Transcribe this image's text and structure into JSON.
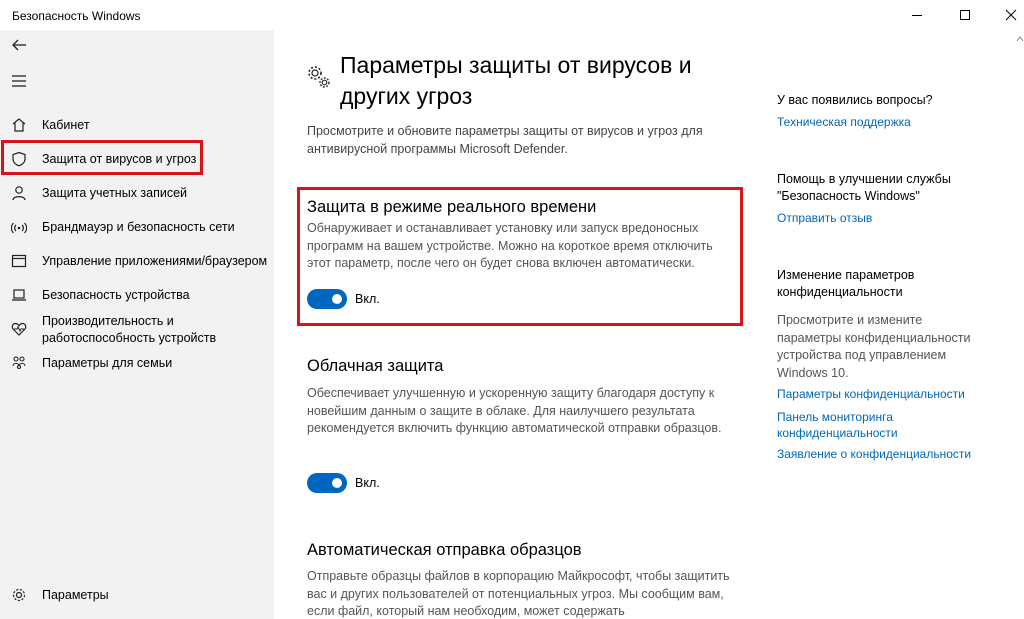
{
  "window": {
    "title": "Безопасность Windows",
    "buttons": {
      "minimize": "minimize-icon",
      "maximize": "maximize-icon",
      "close": "close-icon"
    }
  },
  "sidebar": {
    "back_icon": "back-arrow-icon",
    "menu_icon": "hamburger-icon",
    "items": [
      {
        "label": "Кабинет",
        "icon": "home-icon"
      },
      {
        "label": "Защита от вирусов и угроз",
        "icon": "shield-icon",
        "active": true
      },
      {
        "label": "Защита учетных записей",
        "icon": "person-icon"
      },
      {
        "label": "Брандмауэр и безопасность сети",
        "icon": "wifi-icon"
      },
      {
        "label": "Управление приложениями/браузером",
        "icon": "app-window-icon"
      },
      {
        "label": "Безопасность устройства",
        "icon": "laptop-icon"
      },
      {
        "label": "Производительность и работоспособность устройств",
        "label_line1": "Производительность и",
        "label_line2": "работоспособность устройств",
        "icon": "heart-icon"
      },
      {
        "label": "Параметры для семьи",
        "icon": "family-icon"
      }
    ],
    "settings": {
      "label": "Параметры",
      "icon": "gear-icon"
    }
  },
  "main": {
    "title_line1": "Параметры защиты от вирусов и",
    "title_line2": "других угроз",
    "description": "Просмотрите и обновите параметры защиты от вирусов и угроз для антивирусной программы Microsoft Defender.",
    "sections": [
      {
        "title": "Защита в режиме реального времени",
        "description": "Обнаруживает и останавливает установку или запуск вредоносных программ на вашем устройстве. Можно на короткое время отключить этот параметр, после чего он будет снова включен автоматически.",
        "toggle_label": "Вкл.",
        "toggle_on": true
      },
      {
        "title": "Облачная защита",
        "description": "Обеспечивает улучшенную и ускоренную защиту благодаря доступу к новейшим данным о защите в облаке. Для наилучшего результата рекомендуется включить функцию автоматической отправки образцов.",
        "toggle_label": "Вкл.",
        "toggle_on": true
      },
      {
        "title": "Автоматическая отправка образцов",
        "description": "Отправьте образцы файлов в корпорацию Майкрософт, чтобы защитить вас и других пользователей от потенциальных угроз. Мы сообщим вам, если файл, который нам необходим, может содержать"
      }
    ]
  },
  "right_panel": {
    "questions_title": "У вас появились вопросы?",
    "support_link": "Техническая поддержка",
    "help_title": "Помощь в улучшении службы \"Безопасность Windows\"",
    "help_title_line1": "Помощь в улучшении службы",
    "help_title_line2": "\"Безопасность Windows\"",
    "feedback_link": "Отправить отзыв",
    "privacy_title_line1": "Изменение параметров",
    "privacy_title_line2": "конфиденциальности",
    "privacy_text": "Просмотрите и измените параметры конфиденциальности устройства под управлением Windows 10.",
    "privacy_settings_link": "Параметры конфиденциальности",
    "dashboard_link_line1": "Панель мониторинга",
    "dashboard_link_line2": "конфиденциальности",
    "statement_link": "Заявление о конфиденциальности"
  },
  "colors": {
    "accent": "#0067c0",
    "link": "#0067b8",
    "highlight": "#d7141a",
    "sidebar_bg": "#f2f2f2"
  }
}
